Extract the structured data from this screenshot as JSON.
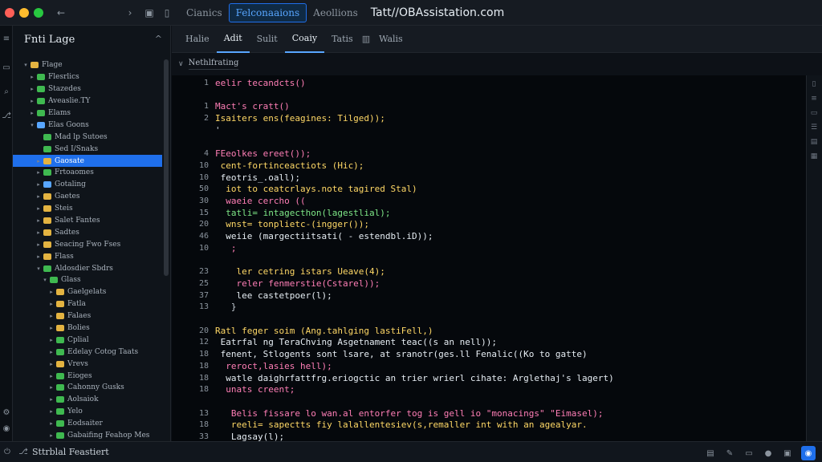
{
  "window": {
    "traffic_colors": [
      "#ff5f57",
      "#febc2e",
      "#28c840"
    ],
    "tabs": [
      {
        "label": "Cianics",
        "active": false
      },
      {
        "label": "Felconaaions",
        "active": true
      },
      {
        "label": "Aeollions",
        "active": false
      }
    ],
    "title": "Tatt//OBAssistation.com"
  },
  "sidebar": {
    "title": "Fnti Lage",
    "items": [
      {
        "label": "Flage",
        "depth": 0,
        "open": true,
        "color": "#e3b341"
      },
      {
        "label": "Flesrlics",
        "depth": 1,
        "open": false,
        "color": "#3fb950"
      },
      {
        "label": "Stazedes",
        "depth": 1,
        "open": false,
        "color": "#3fb950"
      },
      {
        "label": "Aveaslie.TY",
        "depth": 1,
        "open": false,
        "color": "#3fb950"
      },
      {
        "label": "Elams",
        "depth": 1,
        "open": false,
        "color": "#3fb950"
      },
      {
        "label": "Elas Goons",
        "depth": 1,
        "open": true,
        "color": "#58a6ff"
      },
      {
        "label": "Mad lp Sutoes",
        "depth": 2,
        "open": null,
        "color": "#3fb950"
      },
      {
        "label": "Sed I/Snaks",
        "depth": 2,
        "open": null,
        "color": "#3fb950"
      },
      {
        "label": "Gaosate",
        "depth": 2,
        "open": false,
        "color": "#e3b341",
        "selected": true
      },
      {
        "label": "Frtoaomes",
        "depth": 2,
        "open": false,
        "color": "#3fb950"
      },
      {
        "label": "Gotaling",
        "depth": 2,
        "open": false,
        "color": "#58a6ff"
      },
      {
        "label": "Gaetes",
        "depth": 2,
        "open": false,
        "color": "#e3b341"
      },
      {
        "label": "Steis",
        "depth": 2,
        "open": false,
        "color": "#e3b341"
      },
      {
        "label": "Salet Fantes",
        "depth": 2,
        "open": false,
        "color": "#e3b341"
      },
      {
        "label": "Sadtes",
        "depth": 2,
        "open": false,
        "color": "#e3b341"
      },
      {
        "label": "Seacing Fwo Fses",
        "depth": 2,
        "open": false,
        "color": "#e3b341"
      },
      {
        "label": "Flass",
        "depth": 2,
        "open": false,
        "color": "#e3b341"
      },
      {
        "label": "Aldosdier Sbdrs",
        "depth": 2,
        "open": true,
        "color": "#3fb950"
      },
      {
        "label": "Glass",
        "depth": 3,
        "open": true,
        "color": "#3fb950"
      },
      {
        "label": "Gaelgelats",
        "depth": 4,
        "open": false,
        "color": "#e3b341"
      },
      {
        "label": "Fatla",
        "depth": 4,
        "open": false,
        "color": "#e3b341"
      },
      {
        "label": "Falaes",
        "depth": 4,
        "open": false,
        "color": "#e3b341"
      },
      {
        "label": "Bolies",
        "depth": 4,
        "open": false,
        "color": "#e3b341"
      },
      {
        "label": "Cplial",
        "depth": 4,
        "open": false,
        "color": "#3fb950"
      },
      {
        "label": "Edelay Cotog Taats",
        "depth": 4,
        "open": false,
        "color": "#3fb950"
      },
      {
        "label": "Vrevs",
        "depth": 4,
        "open": false,
        "color": "#e3b341"
      },
      {
        "label": "Eioges",
        "depth": 4,
        "open": false,
        "color": "#3fb950"
      },
      {
        "label": "Cahonny Gusks",
        "depth": 4,
        "open": false,
        "color": "#3fb950"
      },
      {
        "label": "Aolsaiok",
        "depth": 4,
        "open": false,
        "color": "#3fb950"
      },
      {
        "label": "Yelo",
        "depth": 4,
        "open": false,
        "color": "#3fb950"
      },
      {
        "label": "Eodsaiter",
        "depth": 4,
        "open": false,
        "color": "#3fb950"
      },
      {
        "label": "Gabaifing Feahop Mes",
        "depth": 4,
        "open": false,
        "color": "#3fb950"
      }
    ]
  },
  "editor": {
    "tabs": [
      {
        "label": "Halie",
        "active": false
      },
      {
        "label": "Adit",
        "active": true
      },
      {
        "label": "Sulit",
        "active": false
      },
      {
        "label": "Coaiy",
        "active": true
      },
      {
        "label": "Tatis",
        "active": false
      },
      {
        "label": "Walis",
        "active": false
      }
    ],
    "breadcrumb": "Nethlfrating",
    "lines": [
      {
        "num": "1",
        "text": "eelir tecandcts()",
        "color": "#ff7eb6"
      },
      {
        "num": "",
        "text": "",
        "color": "#c9d1d9"
      },
      {
        "num": "1",
        "text": "Mact's cratt()",
        "color": "#ff7eb6"
      },
      {
        "num": "2",
        "text": "Isaiters ens(feagines: Tilged));",
        "color": "#ffd866"
      },
      {
        "num": "",
        "text": "'",
        "color": "#c9d1d9"
      },
      {
        "num": "",
        "text": "",
        "color": "#c9d1d9"
      },
      {
        "num": "4",
        "text": "FEeolkes ereet());",
        "color": "#ff7eb6"
      },
      {
        "num": "10",
        "text": " cent-fortinceactiots (Hic);",
        "color": "#ffd866"
      },
      {
        "num": "10",
        "text": " feotris_.oall);",
        "color": "#e6edf3"
      },
      {
        "num": "50",
        "text": "  iot to ceatcrlays.note tagired Stal)",
        "color": "#ffd866"
      },
      {
        "num": "30",
        "text": "  waeie cercho ((",
        "color": "#ff7eb6"
      },
      {
        "num": "15",
        "text": "  tatli= intagecthon(lagestlial);",
        "color": "#7ee787"
      },
      {
        "num": "20",
        "text": "  wnst= tonplietc-(ingger());",
        "color": "#ffd866"
      },
      {
        "num": "46",
        "text": "  weiie (margectiitsati( - estendbl.iD));",
        "color": "#e6edf3"
      },
      {
        "num": "10",
        "text": "   ;",
        "color": "#ff7eb6"
      },
      {
        "num": "",
        "text": "",
        "color": "#c9d1d9"
      },
      {
        "num": "23",
        "text": "    ler cetring istars Ueave(4);",
        "color": "#ffd866"
      },
      {
        "num": "25",
        "text": "    reler fenmerstie(Cstarel));",
        "color": "#ff7eb6"
      },
      {
        "num": "37",
        "text": "    lee castetpoer(l);",
        "color": "#e6edf3"
      },
      {
        "num": "13",
        "text": "   }",
        "color": "#c9d1d9"
      },
      {
        "num": "",
        "text": "",
        "color": "#c9d1d9"
      },
      {
        "num": "20",
        "text": "Ratl feger soim (Ang.tahlging lastiFell,)",
        "color": "#ffd866"
      },
      {
        "num": "12",
        "text": " Eatrfal ng TeraChving Asgetnament teac((s an nell));",
        "color": "#e6edf3"
      },
      {
        "num": "18",
        "text": " fenent, Stlogents sont lsare, at sranotr(ges.ll Fenalic((Ko to gatte)",
        "color": "#e6edf3"
      },
      {
        "num": "18",
        "text": "  reroct,lasies hell);",
        "color": "#ff7eb6"
      },
      {
        "num": "18",
        "text": "  watle daighrfattfrg.eriogctic an trier wrierl cihate: Arglethaj's lagert)",
        "color": "#e6edf3"
      },
      {
        "num": "18",
        "text": "  unats creent;",
        "color": "#ff7eb6"
      },
      {
        "num": "",
        "text": "",
        "color": "#c9d1d9"
      },
      {
        "num": "13",
        "text": "   Belis fissare lo wan.al entorfer tog is gell io \"monacings\" \"Eimasel);",
        "color": "#ff7eb6"
      },
      {
        "num": "18",
        "text": "   reeli= sapectts fiy lalallentesiev(s,remaller int with an agealyar.",
        "color": "#ffd866"
      },
      {
        "num": "33",
        "text": "   Lagsay(l);",
        "color": "#e6edf3"
      }
    ]
  },
  "statusbar": {
    "label": "Sttrblal Feastiert"
  }
}
